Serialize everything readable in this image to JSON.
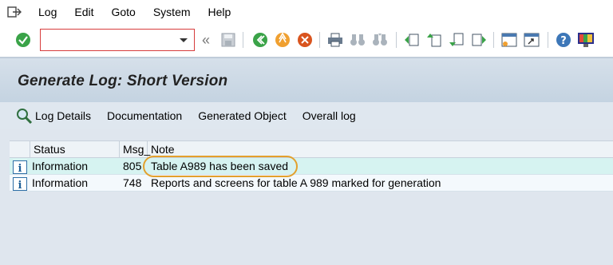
{
  "menu": {
    "items": [
      {
        "key": "log",
        "label": "Log"
      },
      {
        "key": "edit",
        "label": "Edit"
      },
      {
        "key": "goto",
        "label": "Goto"
      },
      {
        "key": "system",
        "label": "System"
      },
      {
        "key": "help",
        "label": "Help"
      }
    ]
  },
  "toolbar": {
    "command_field_value": "",
    "command_field_placeholder": ""
  },
  "page": {
    "title": "Generate Log: Short Version"
  },
  "app_toolbar": {
    "log_details": "Log Details",
    "documentation": "Documentation",
    "generated_object": "Generated Object",
    "overall_log": "Overall log"
  },
  "table": {
    "headers": {
      "status": "Status",
      "msg": "Msg_",
      "note": "Note"
    },
    "rows": [
      {
        "status": "Information",
        "msg": "805",
        "note": "Table A989 has been saved",
        "icon": "info-icon"
      },
      {
        "status": "Information",
        "msg": "748",
        "note": "Reports and screens for table A 989 marked for generation",
        "icon": "info-icon"
      }
    ]
  },
  "colors": {
    "highlight": "#e3a02c",
    "selected_row": "#d6f3f1",
    "accent_blue": "#1d5f98"
  }
}
